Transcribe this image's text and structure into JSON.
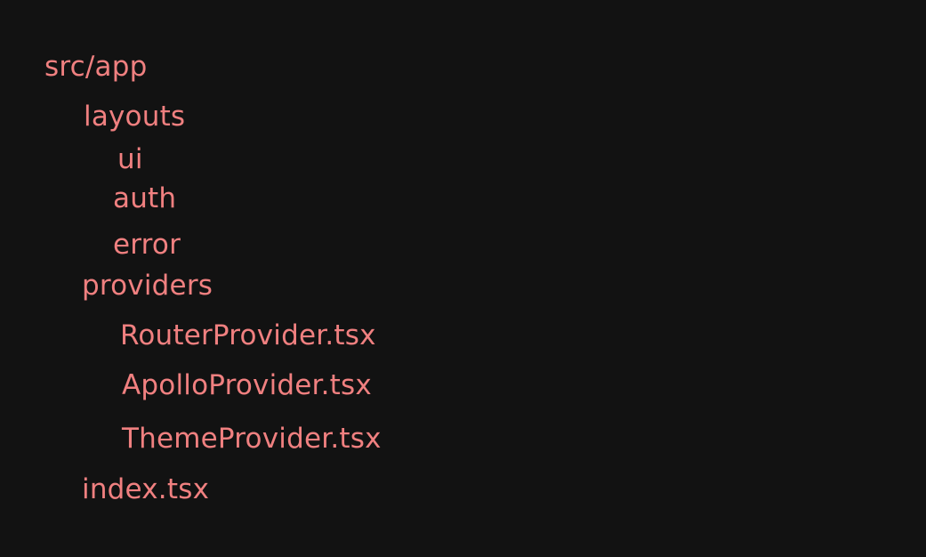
{
  "tree": {
    "root": "src/app",
    "layouts": {
      "name": "layouts",
      "children": [
        "ui",
        "auth",
        "error"
      ]
    },
    "providers": {
      "name": "providers",
      "children": [
        "RouterProvider.tsx",
        "ApolloProvider.tsx",
        "ThemeProvider.tsx"
      ]
    },
    "index": "index.tsx"
  },
  "colors": {
    "background": "#121212",
    "text": "#f08080"
  }
}
